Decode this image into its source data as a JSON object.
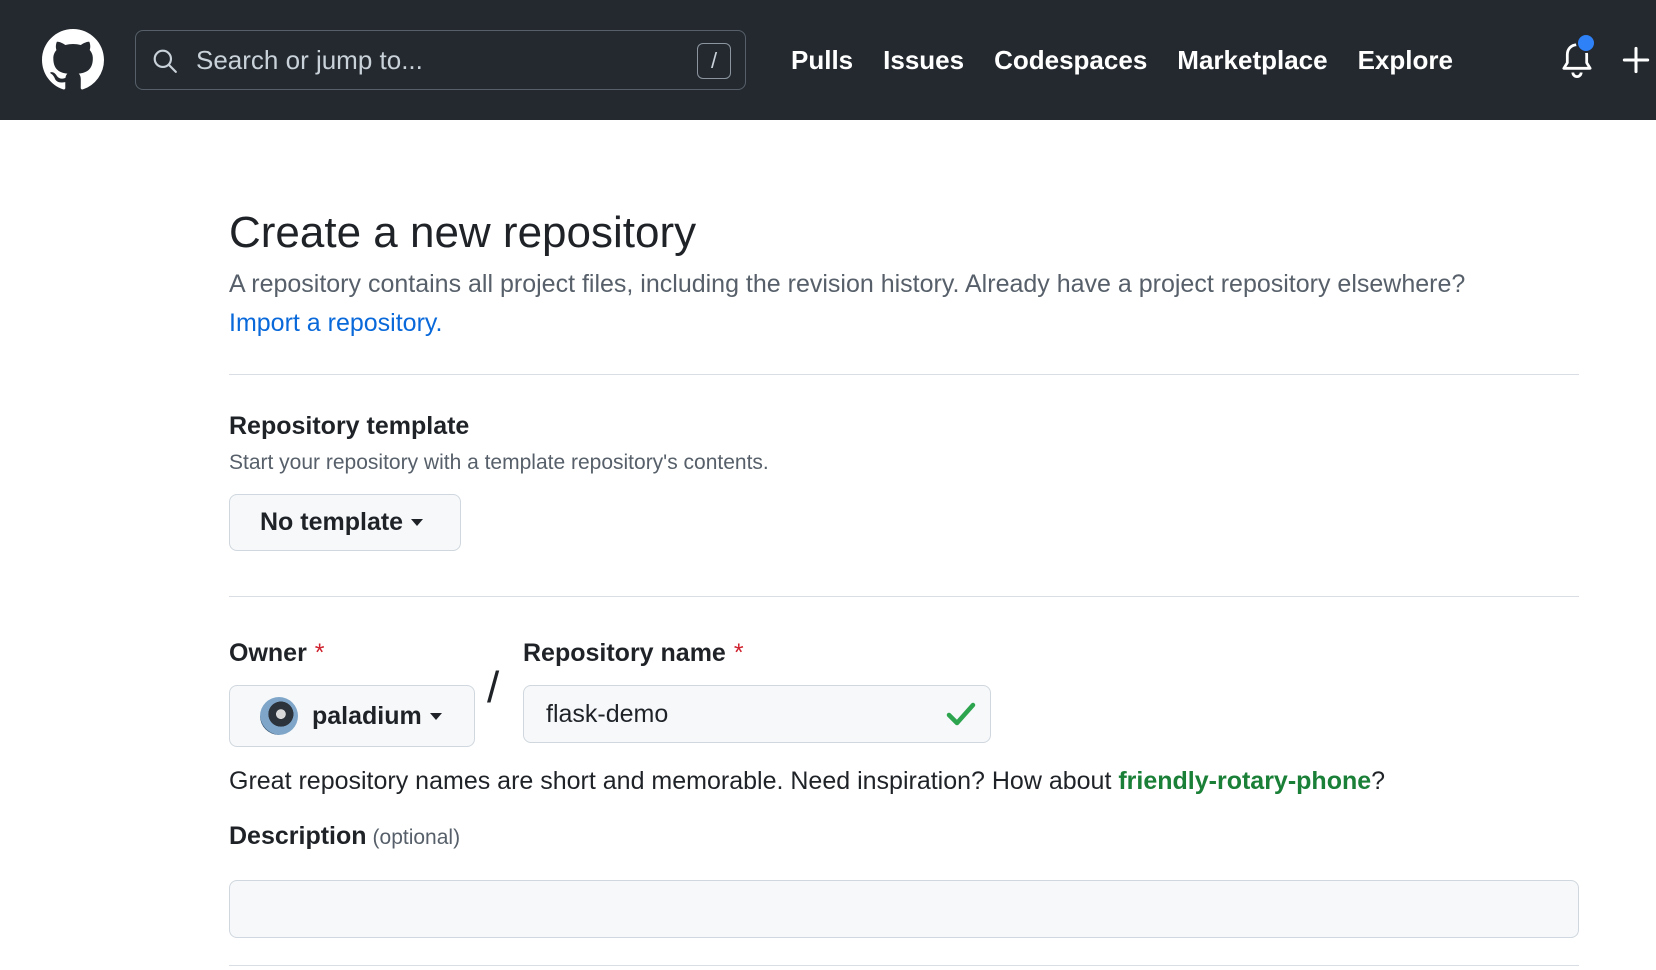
{
  "header": {
    "search_placeholder": "Search or jump to...",
    "search_shortcut": "/",
    "nav": [
      "Pulls",
      "Issues",
      "Codespaces",
      "Marketplace",
      "Explore"
    ]
  },
  "page": {
    "title": "Create a new repository",
    "intro": "A repository contains all project files, including the revision history. Already have a project repository elsewhere?",
    "import_link": "Import a repository."
  },
  "template": {
    "title": "Repository template",
    "note": "Start your repository with a template repository's contents.",
    "selected": "No template"
  },
  "owner": {
    "label": "Owner",
    "required": "*",
    "value": "paladium"
  },
  "repo_name": {
    "label": "Repository name",
    "required": "*",
    "value": "flask-demo",
    "separator": "/"
  },
  "hint": {
    "prefix": "Great repository names are short and memorable. Need inspiration? How about ",
    "suggestion": "friendly-rotary-phone",
    "suffix": "?"
  },
  "description": {
    "label": "Description",
    "optional": "(optional)",
    "value": ""
  },
  "colors": {
    "header_bg": "#24292f",
    "link": "#0969da",
    "success": "#1a7f37",
    "required": "#cf222e",
    "notification": "#2f81f7"
  }
}
